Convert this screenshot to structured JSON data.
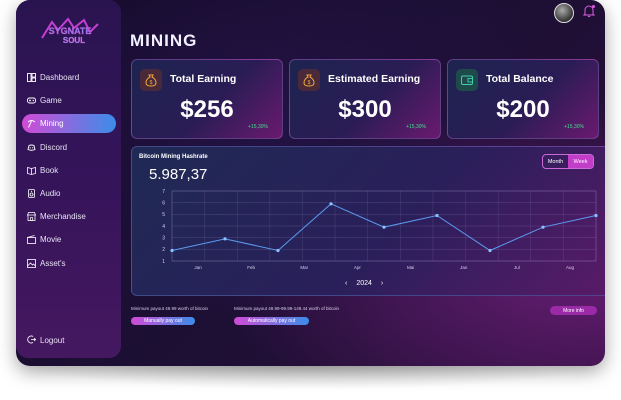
{
  "app": {
    "logo_text": "SYGNATE SOUL"
  },
  "sidebar": {
    "items": [
      {
        "label": "Dashboard",
        "icon": "dashboard-icon"
      },
      {
        "label": "Game",
        "icon": "gamepad-icon"
      },
      {
        "label": "Mining",
        "icon": "pickaxe-icon",
        "active": true
      },
      {
        "label": "Discord",
        "icon": "discord-icon"
      },
      {
        "label": "Book",
        "icon": "book-icon"
      },
      {
        "label": "Audio",
        "icon": "audio-icon"
      },
      {
        "label": "Merchandise",
        "icon": "store-icon"
      },
      {
        "label": "Movie",
        "icon": "movie-icon"
      },
      {
        "label": "Asset's",
        "icon": "image-icon"
      }
    ],
    "logout_label": "Logout"
  },
  "header": {
    "title": "MINING"
  },
  "cards": [
    {
      "title": "Total Earning",
      "value": "$256",
      "delta": "+15,30%",
      "icon": "money-bag-icon"
    },
    {
      "title": "Estimated Earning",
      "value": "$300",
      "delta": "+15,30%",
      "icon": "money-bag-icon"
    },
    {
      "title": "Total Balance",
      "value": "$200",
      "delta": "+15,30%",
      "icon": "wallet-icon"
    }
  ],
  "chart_panel": {
    "title": "Bitcoin Mining Hashrate",
    "value": "5.987,37",
    "toggle": {
      "month": "Month",
      "week": "Week",
      "selected": "Week"
    },
    "year": "2024"
  },
  "chart_data": {
    "type": "line",
    "title": "Bitcoin Mining Hashrate",
    "categories": [
      "Jan",
      "Feb",
      "Mar",
      "Apr",
      "Mai",
      "Jan",
      "Jul",
      "Aug"
    ],
    "x_positions": [
      0,
      1,
      2,
      3,
      4,
      5,
      6,
      7,
      8,
      9,
      10,
      11,
      12,
      13
    ],
    "values": [
      1.9,
      2.9,
      1.9,
      5.9,
      3.9,
      4.9,
      1.9,
      3.9,
      4.9
    ],
    "yticks": [
      1,
      2,
      3,
      4,
      5,
      6,
      7
    ],
    "ylim": [
      1,
      7
    ],
    "grid": true,
    "color": "#5b9cf0"
  },
  "footer": {
    "manual_note": "Minimum payout 49.99 worth of bitcoin",
    "manual_button": "Manually pay out",
    "auto_note": "Minimum payout 49.99-99.99-149.44 worth of bitcoin",
    "auto_button": "Automatically pay out",
    "more_info": "More info"
  }
}
